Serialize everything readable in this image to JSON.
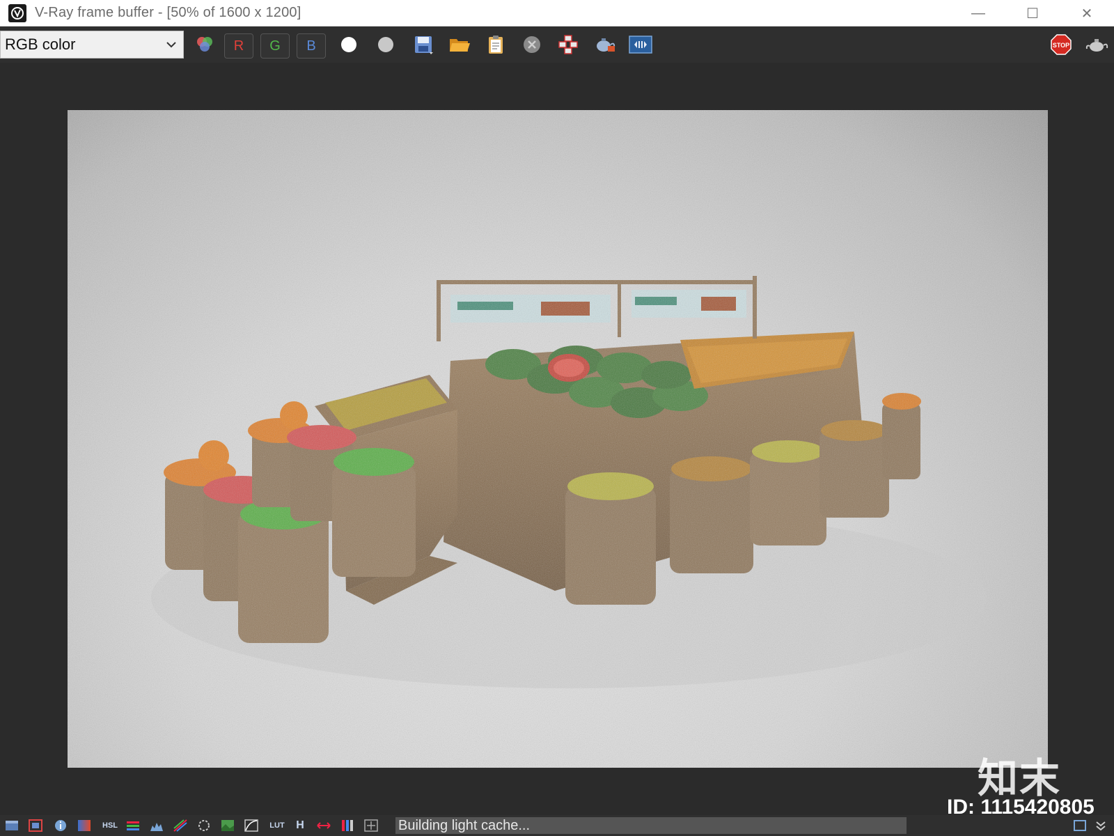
{
  "window": {
    "title": "V-Ray frame buffer - [50% of 1600 x 1200]",
    "minimize": "—",
    "maximize": "☐",
    "close": "✕"
  },
  "toolbar": {
    "channel_value": "RGB color",
    "r_label": "R",
    "g_label": "G",
    "b_label": "B",
    "r_color": "#e0403a",
    "g_color": "#52b84a",
    "b_color": "#5a8ad8",
    "stop_label": "STOP"
  },
  "status": {
    "text": "Building light cache..."
  },
  "watermark": {
    "logo": "知末",
    "id": "ID: 1115420805"
  },
  "statusbar_icons": [
    "window-icon",
    "frame-icon",
    "info-icon",
    "gradient-icon",
    "hsl-icon",
    "balance-icon",
    "histogram-icon",
    "levels-icon",
    "lens-icon",
    "image-icon",
    "curve-icon",
    "lut-icon",
    "h-icon",
    "stretch-icon",
    "exposure-icon",
    "compare-icon"
  ],
  "statusbar_labels": {
    "hsl": "HSL",
    "lut": "LUT",
    "h": "H"
  }
}
